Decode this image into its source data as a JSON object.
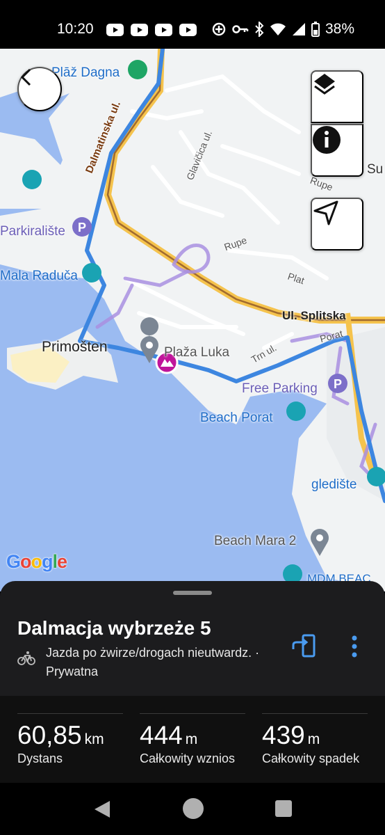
{
  "status": {
    "time": "10:20",
    "battery": "38%"
  },
  "map": {
    "labels": {
      "plaz_dagna": "Plāž Dagna",
      "dalmatinska": "Dalmatinska ul.",
      "glavicica": "Glavičica ul.",
      "su": "Su",
      "rupe1": "Rupe",
      "rupe2": "Rupe",
      "parkiraliste": "Parkiralište",
      "mala_raduca": "Mala Raduča",
      "plat": "Plat",
      "splitska": "Ul. Splitska",
      "primosten": "Primošten",
      "plaza_luka": "Plaža Luka",
      "trn": "Trn ul.",
      "porat": "Porat",
      "free_parking": "Free Parking",
      "beach_porat": "Beach Porat",
      "glediste": "gledište",
      "beach_mara": "Beach Mara 2",
      "mdm": "MDM BEAC"
    },
    "attribution": "Google"
  },
  "route": {
    "title": "Dalmacja wybrzeże 5",
    "activity": "Jazda po żwirze/drogach nieutwardz. ·",
    "visibility": "Prywatna"
  },
  "stats": [
    {
      "value": "60,85",
      "unit": "km",
      "label": "Dystans"
    },
    {
      "value": "444",
      "unit": "m",
      "label": "Całkowity wznios"
    },
    {
      "value": "439",
      "unit": "m",
      "label": "Całkowity spadek"
    }
  ],
  "colors": {
    "route": "#3d86e0",
    "accent": "#4a9bf0",
    "start_marker": "#c0159a"
  }
}
